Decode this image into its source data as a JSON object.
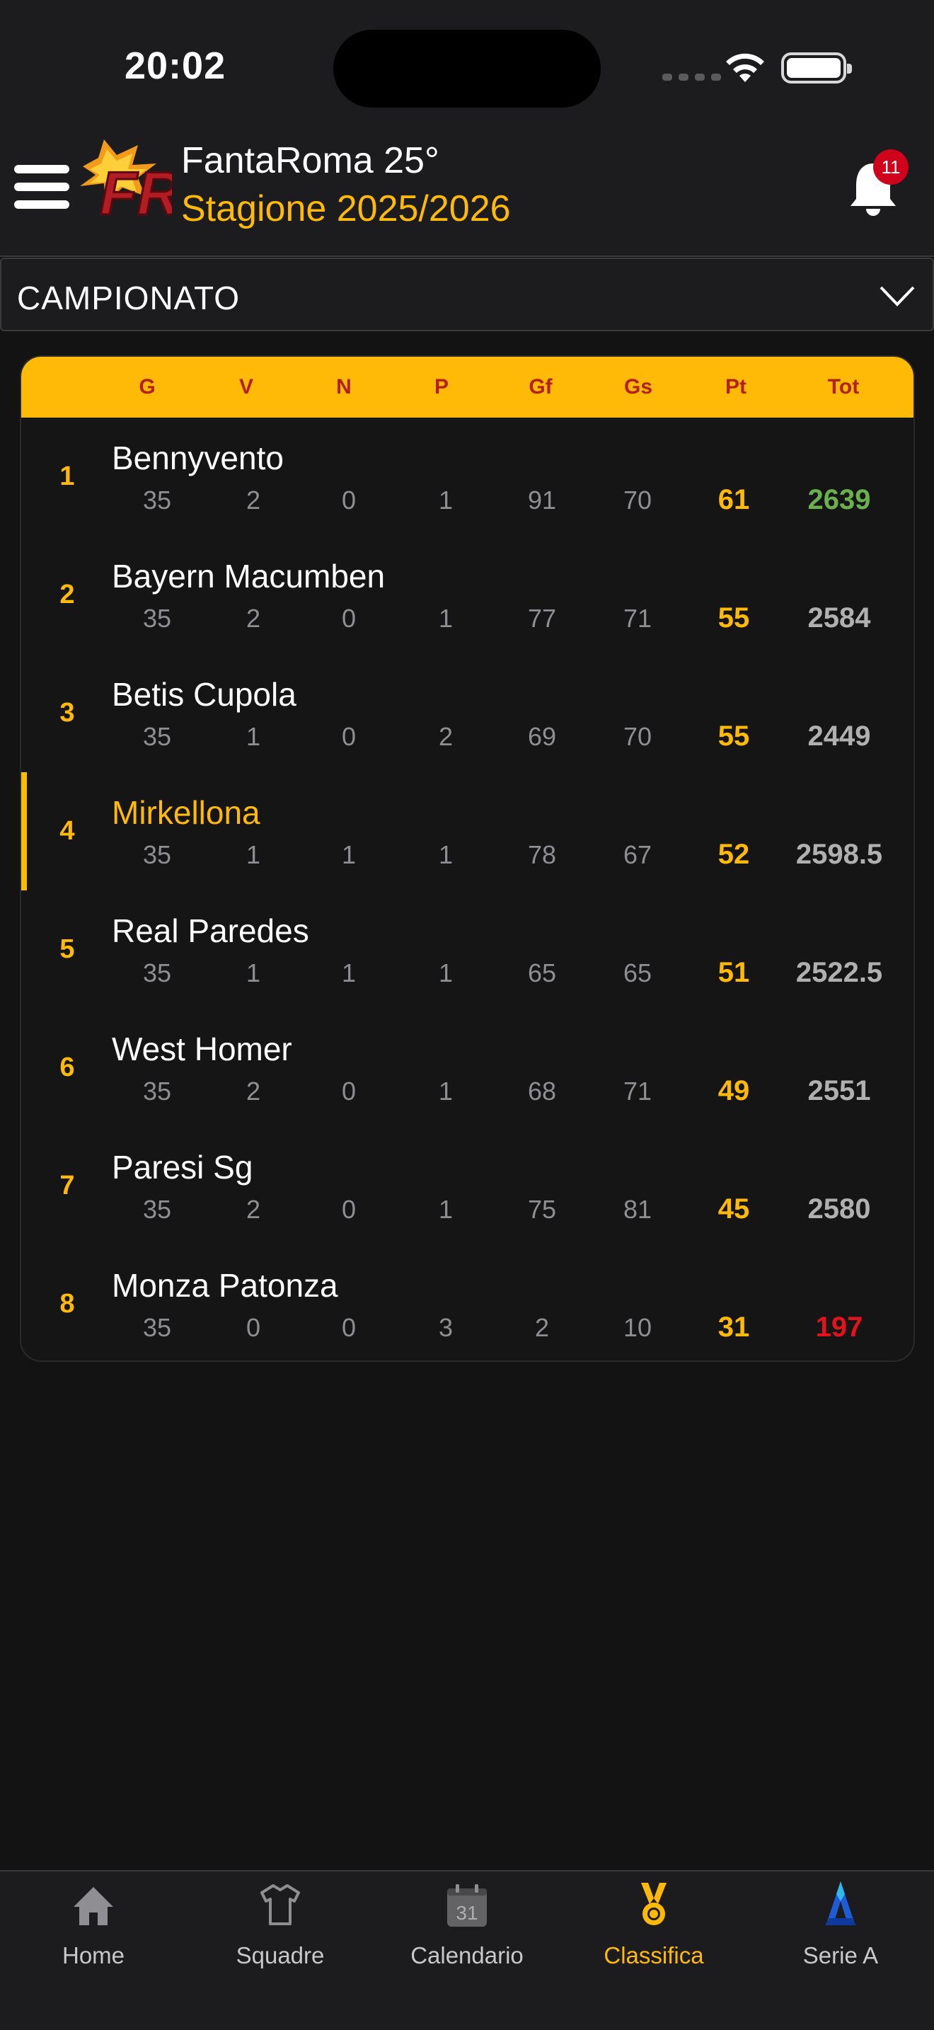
{
  "status": {
    "time": "20:02"
  },
  "header": {
    "title": "FantaRoma 25°",
    "season": "Stagione 2025/2026",
    "notifications_count": "11",
    "logo_text": "FR"
  },
  "filter": {
    "selected": "CAMPIONATO"
  },
  "standings": {
    "columns": [
      "G",
      "V",
      "N",
      "P",
      "Gf",
      "Gs",
      "Pt",
      "Tot"
    ],
    "rows": [
      {
        "pos": "1",
        "team": "Bennyvento",
        "g": "35",
        "v": "2",
        "n": "0",
        "p": "1",
        "gf": "91",
        "gs": "70",
        "pt": "61",
        "tot": "2639"
      },
      {
        "pos": "2",
        "team": "Bayern Macumben",
        "g": "35",
        "v": "2",
        "n": "0",
        "p": "1",
        "gf": "77",
        "gs": "71",
        "pt": "55",
        "tot": "2584"
      },
      {
        "pos": "3",
        "team": "Betis Cupola",
        "g": "35",
        "v": "1",
        "n": "0",
        "p": "2",
        "gf": "69",
        "gs": "70",
        "pt": "55",
        "tot": "2449"
      },
      {
        "pos": "4",
        "team": "Mirkellona",
        "g": "35",
        "v": "1",
        "n": "1",
        "p": "1",
        "gf": "78",
        "gs": "67",
        "pt": "52",
        "tot": "2598.5"
      },
      {
        "pos": "5",
        "team": "Real Paredes",
        "g": "35",
        "v": "1",
        "n": "1",
        "p": "1",
        "gf": "65",
        "gs": "65",
        "pt": "51",
        "tot": "2522.5"
      },
      {
        "pos": "6",
        "team": "West Homer",
        "g": "35",
        "v": "2",
        "n": "0",
        "p": "1",
        "gf": "68",
        "gs": "71",
        "pt": "49",
        "tot": "2551"
      },
      {
        "pos": "7",
        "team": "Paresi Sg",
        "g": "35",
        "v": "2",
        "n": "0",
        "p": "1",
        "gf": "75",
        "gs": "81",
        "pt": "45",
        "tot": "2580"
      },
      {
        "pos": "8",
        "team": "Monza Patonza",
        "g": "35",
        "v": "0",
        "n": "0",
        "p": "3",
        "gf": "2",
        "gs": "10",
        "pt": "31",
        "tot": "197"
      }
    ]
  },
  "tabbar": {
    "tabs": [
      {
        "label": "Home",
        "icon": "home-icon"
      },
      {
        "label": "Squadre",
        "icon": "shirt-icon"
      },
      {
        "label": "Calendario",
        "icon": "calendar-icon",
        "icon_text": "31"
      },
      {
        "label": "Classifica",
        "icon": "medal-icon",
        "active": true
      },
      {
        "label": "Serie A",
        "icon": "serie-a-logo-icon"
      }
    ]
  },
  "colors": {
    "accent": "#ffba08",
    "background": "#131314",
    "surface": "#1c1c1e",
    "header_text": "#b3211b",
    "positive": "#6ab04c",
    "negative": "#e3121d",
    "badge": "#d0021b"
  }
}
